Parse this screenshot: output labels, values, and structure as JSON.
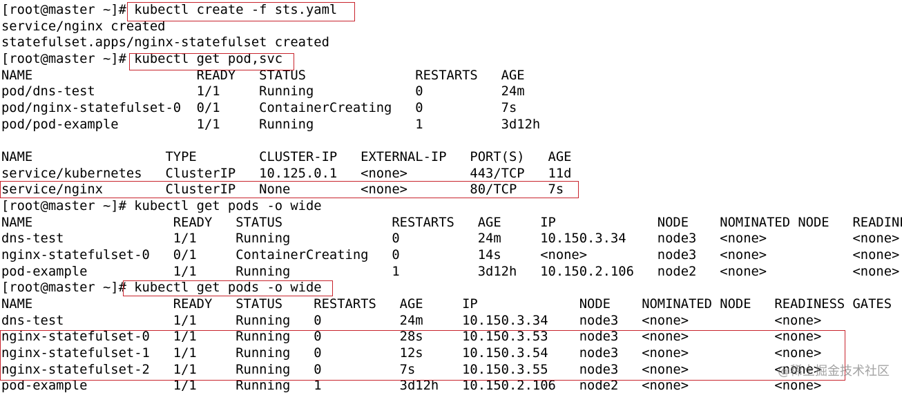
{
  "terminal": {
    "lines": [
      "[root@master ~]# kubectl create -f sts.yaml",
      "service/nginx created",
      "statefulset.apps/nginx-statefulset created",
      "[root@master ~]# kubectl get pod,svc",
      "NAME                     READY   STATUS              RESTARTS   AGE",
      "pod/dns-test             1/1     Running             0          24m",
      "pod/nginx-statefulset-0  0/1     ContainerCreating   0          7s",
      "pod/pod-example          1/1     Running             1          3d12h",
      "",
      "NAME                 TYPE        CLUSTER-IP   EXTERNAL-IP   PORT(S)   AGE",
      "service/kubernetes   ClusterIP   10.125.0.1   <none>        443/TCP   11d",
      "service/nginx        ClusterIP   None         <none>        80/TCP    7s",
      "[root@master ~]# kubectl get pods -o wide",
      "NAME                  READY   STATUS              RESTARTS   AGE     IP             NODE    NOMINATED NODE   READINESS GATES",
      "dns-test              1/1     Running             0          24m     10.150.3.34    node3   <none>           <none>",
      "nginx-statefulset-0   0/1     ContainerCreating   0          14s     <none>         node3   <none>           <none>",
      "pod-example           1/1     Running             1          3d12h   10.150.2.106   node2   <none>           <none>",
      "[root@master ~]# kubectl get pods -o wide",
      "NAME                  READY   STATUS    RESTARTS   AGE     IP             NODE    NOMINATED NODE   READINESS GATES",
      "dns-test              1/1     Running   0          24m     10.150.3.34    node3   <none>           <none>",
      "nginx-statefulset-0   1/1     Running   0          28s     10.150.3.53    node3   <none>           <none>",
      "nginx-statefulset-1   1/1     Running   0          12s     10.150.3.54    node3   <none>           <none>",
      "nginx-statefulset-2   1/1     Running   0          7s      10.150.3.55    node3   <none>           <none>",
      "pod-example           1/1     Running   1          3d12h   10.150.2.106   node2   <none>           <none>"
    ]
  },
  "watermark": "@稀土掘金技术社区",
  "colors": {
    "background": "#ffffff",
    "text": "#000000",
    "highlight_box": "#c8232c"
  }
}
